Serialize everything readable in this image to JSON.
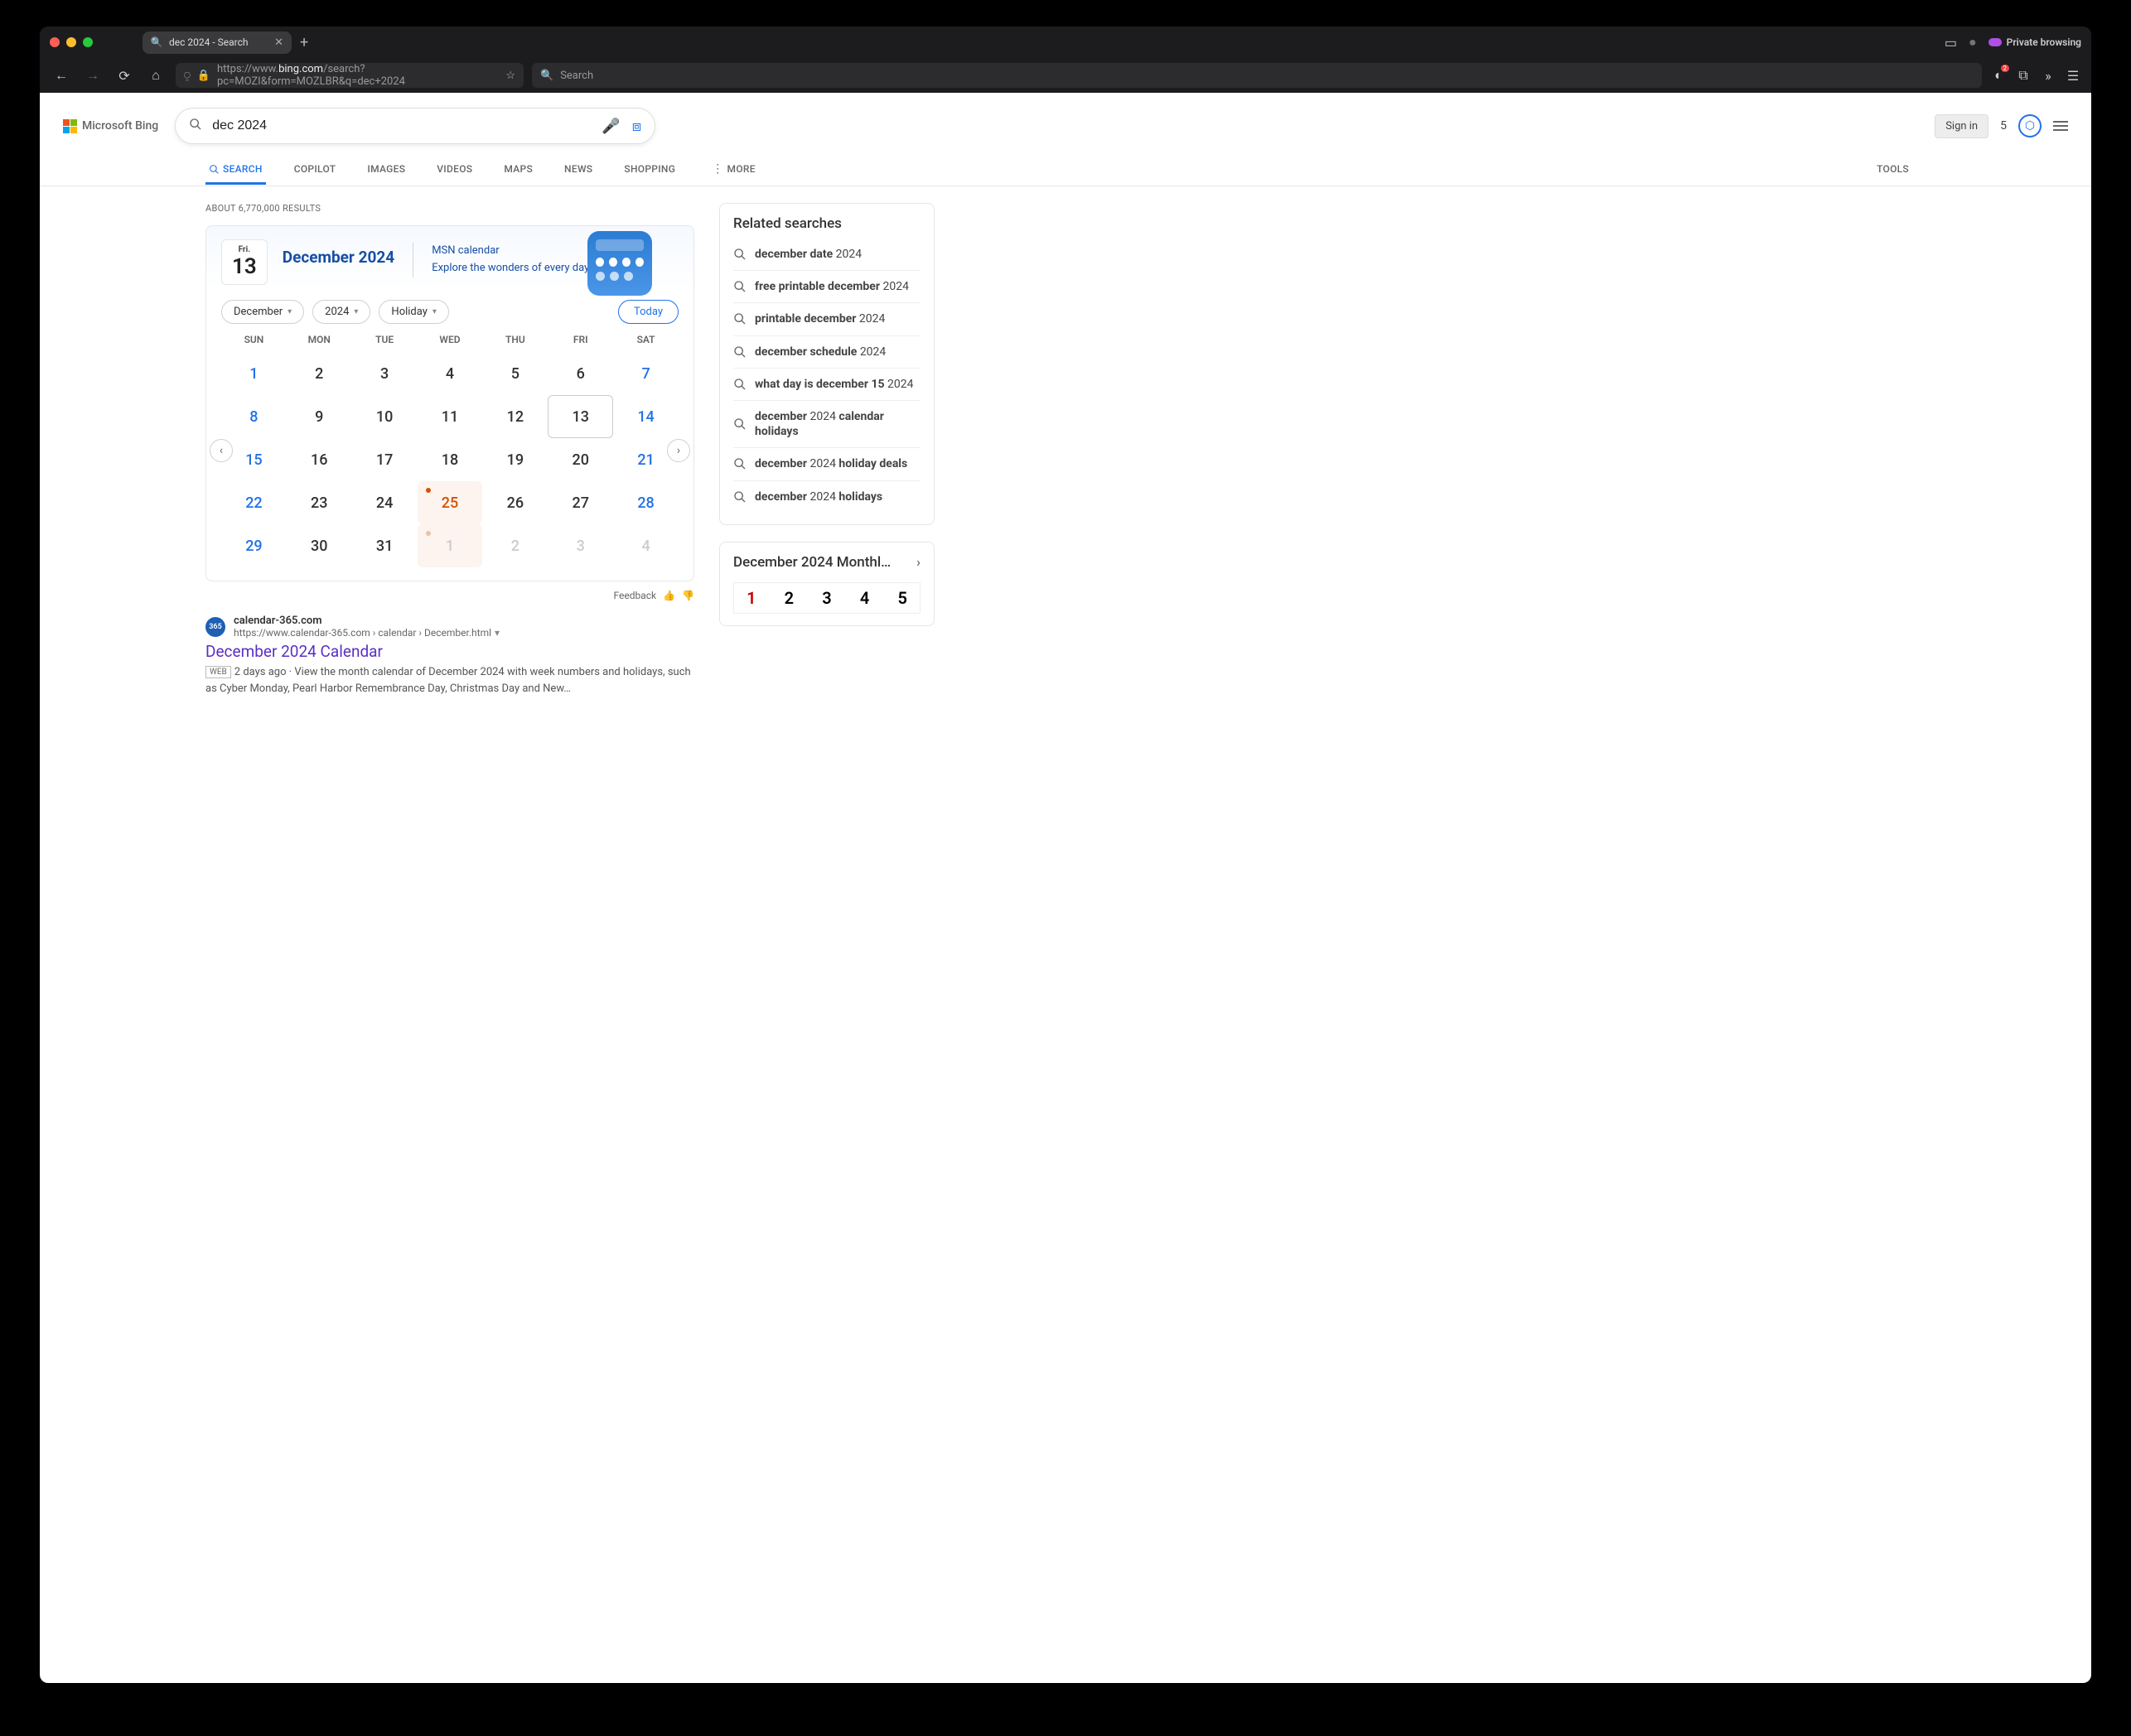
{
  "browser": {
    "tab_title": "dec 2024 - Search",
    "private_label": "Private browsing",
    "url_prefix": "https://www.",
    "url_domain": "bing.com",
    "url_path": "/search?pc=MOZI&form=MOZLBR&q=dec+2024",
    "search_placeholder": "Search",
    "tb_badge": "2"
  },
  "bing": {
    "logo_text": "Microsoft Bing",
    "query": "dec 2024",
    "signin": "Sign in",
    "points": "5",
    "tabs": [
      "SEARCH",
      "COPILOT",
      "IMAGES",
      "VIDEOS",
      "MAPS",
      "NEWS",
      "SHOPPING"
    ],
    "more": "MORE",
    "tools": "TOOLS",
    "about": "ABOUT 6,770,000 RESULTS"
  },
  "calendar": {
    "today_label": "Fri.",
    "today_num": "13",
    "title": "December 2024",
    "msn_link": "MSN calendar",
    "msn_sub": "Explore the wonders of every day",
    "month_sel": "December",
    "year_sel": "2024",
    "holiday_sel": "Holiday",
    "today_btn": "Today",
    "weekdays": [
      "SUN",
      "MON",
      "TUE",
      "WED",
      "THU",
      "FRI",
      "SAT"
    ],
    "days": [
      {
        "n": "1",
        "w": true
      },
      {
        "n": "2"
      },
      {
        "n": "3"
      },
      {
        "n": "4"
      },
      {
        "n": "5"
      },
      {
        "n": "6"
      },
      {
        "n": "7",
        "w": true
      },
      {
        "n": "8",
        "w": true
      },
      {
        "n": "9"
      },
      {
        "n": "10"
      },
      {
        "n": "11"
      },
      {
        "n": "12"
      },
      {
        "n": "13",
        "t": true
      },
      {
        "n": "14",
        "w": true
      },
      {
        "n": "15",
        "w": true
      },
      {
        "n": "16"
      },
      {
        "n": "17"
      },
      {
        "n": "18"
      },
      {
        "n": "19"
      },
      {
        "n": "20"
      },
      {
        "n": "21",
        "w": true
      },
      {
        "n": "22",
        "w": true
      },
      {
        "n": "23"
      },
      {
        "n": "24"
      },
      {
        "n": "25",
        "h": true
      },
      {
        "n": "26"
      },
      {
        "n": "27"
      },
      {
        "n": "28",
        "w": true
      },
      {
        "n": "29",
        "w": true
      },
      {
        "n": "30"
      },
      {
        "n": "31"
      },
      {
        "n": "1",
        "h": true,
        "o": true
      },
      {
        "n": "2",
        "o": true
      },
      {
        "n": "3",
        "o": true
      },
      {
        "n": "4",
        "o": true,
        "w": true
      }
    ],
    "feedback": "Feedback"
  },
  "result1": {
    "site": "calendar-365.com",
    "url": "https://www.calendar-365.com › calendar › December.html",
    "title": "December 2024 Calendar",
    "web_tag": "WEB",
    "age": "2 days ago",
    "snippet": "View the month calendar of December 2024 with week numbers and holidays, such as Cyber Monday, Pearl Harbor Remembrance Day, Christmas Day and New…"
  },
  "related": {
    "heading": "Related searches",
    "items": [
      [
        {
          "b": "december date"
        },
        {
          "t": " 2024"
        }
      ],
      [
        {
          "b": "free printable december"
        },
        {
          "t": " 2024"
        }
      ],
      [
        {
          "b": "printable december"
        },
        {
          "t": " 2024"
        }
      ],
      [
        {
          "b": "december schedule"
        },
        {
          "t": " 2024"
        }
      ],
      [
        {
          "b": "what day is december 15"
        },
        {
          "t": " 2024"
        }
      ],
      [
        {
          "b": "december"
        },
        {
          "t": " 2024 "
        },
        {
          "b": "calendar holidays"
        }
      ],
      [
        {
          "b": "december"
        },
        {
          "t": " 2024 "
        },
        {
          "b": "holiday deals"
        }
      ],
      [
        {
          "b": "december"
        },
        {
          "t": " 2024 "
        },
        {
          "b": "holidays"
        }
      ]
    ]
  },
  "monthly": {
    "title": "December 2024 Monthl…",
    "days": [
      "1",
      "2",
      "3",
      "4",
      "5"
    ]
  }
}
